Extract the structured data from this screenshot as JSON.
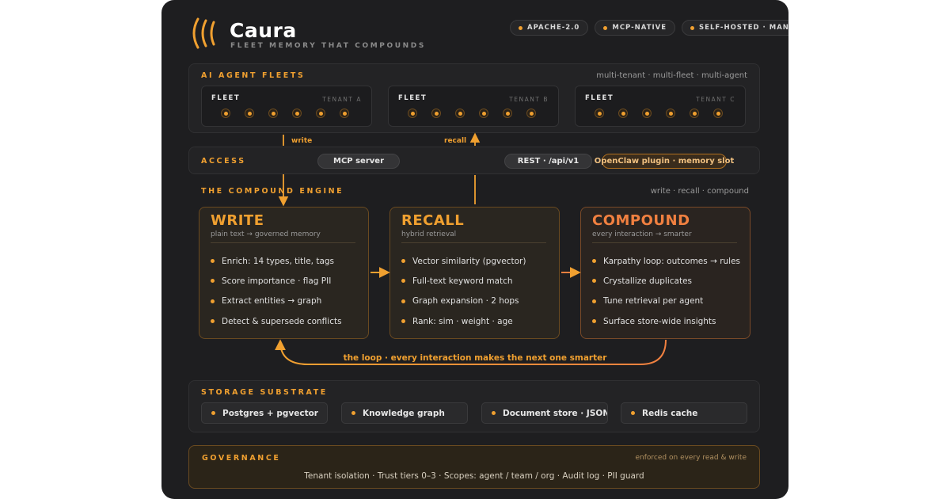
{
  "header": {
    "brand": "Caura",
    "tagline": "FLEET MEMORY THAT COMPOUNDS",
    "badges": [
      "APACHE-2.0",
      "MCP-NATIVE",
      "SELF-HOSTED · MANAGED"
    ]
  },
  "fleets": {
    "title": "AI AGENT FLEETS",
    "note": "multi-tenant · multi-fleet · multi-agent",
    "items": [
      {
        "label": "FLEET",
        "tenant": "TENANT A"
      },
      {
        "label": "FLEET",
        "tenant": "TENANT B"
      },
      {
        "label": "FLEET",
        "tenant": "TENANT C"
      }
    ]
  },
  "flows": {
    "write": "write",
    "recall": "recall"
  },
  "access": {
    "title": "ACCESS",
    "items": [
      "MCP server",
      "REST · /api/v1",
      "OpenClaw plugin · memory slot"
    ]
  },
  "engine": {
    "title": "THE COMPOUND ENGINE",
    "note": "write · recall · compound",
    "cards": [
      {
        "title": "WRITE",
        "subtitle": "plain text → governed memory",
        "items": [
          "Enrich: 14 types, title, tags",
          "Score importance · flag PII",
          "Extract entities → graph",
          "Detect & supersede conflicts"
        ]
      },
      {
        "title": "RECALL",
        "subtitle": "hybrid retrieval",
        "items": [
          "Vector similarity (pgvector)",
          "Full-text keyword match",
          "Graph expansion · 2 hops",
          "Rank: sim · weight · age"
        ]
      },
      {
        "title": "COMPOUND",
        "subtitle": "every interaction → smarter",
        "items": [
          "Karpathy loop: outcomes → rules",
          "Crystallize duplicates",
          "Tune retrieval per agent",
          "Surface store-wide insights"
        ]
      }
    ],
    "loop_label": "the loop · every interaction makes the next one smarter"
  },
  "storage": {
    "title": "STORAGE SUBSTRATE",
    "items": [
      "Postgres + pgvector",
      "Knowledge graph",
      "Document store · JSONB",
      "Redis cache"
    ]
  },
  "governance": {
    "title": "GOVERNANCE",
    "note": "enforced on every read & write",
    "body": "Tenant isolation · Trust tiers 0–3 · Scopes: agent / team / org · Audit log · PII guard"
  },
  "colors": {
    "accent": "#f0a030",
    "compound": "#f08040",
    "background": "#1e1e20"
  }
}
